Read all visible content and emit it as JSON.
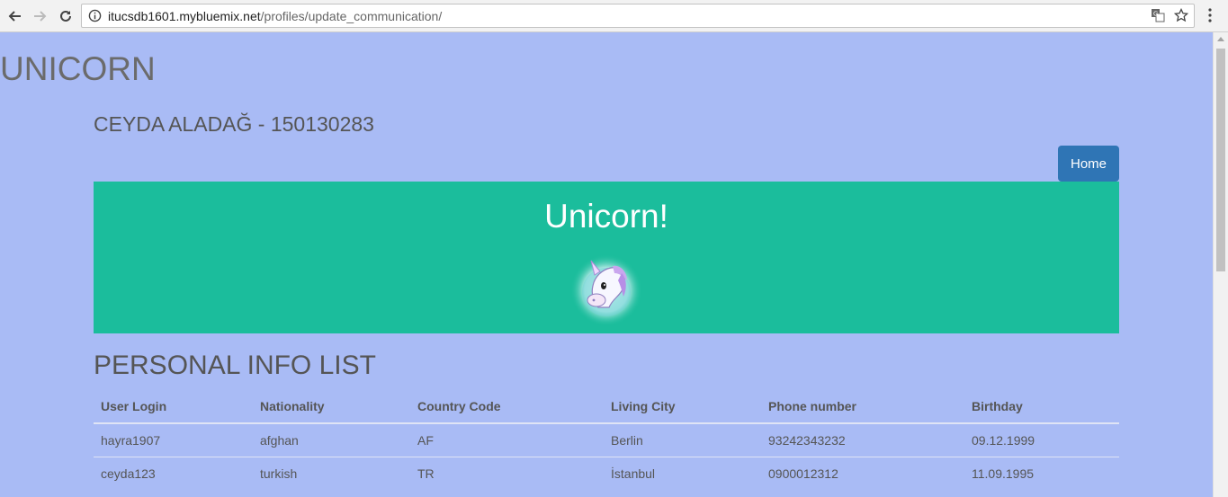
{
  "browser": {
    "url_host": "itucsdb1601.mybluemix.net",
    "url_path": "/profiles/update_communication/"
  },
  "site_title": "UNICORN",
  "person_heading": "CEYDA ALADAĞ - 150130283",
  "nav": {
    "home_label": "Home"
  },
  "hero": {
    "title": "Unicorn!",
    "image_icon": "unicorn-icon"
  },
  "section_title": "PERSONAL INFO LIST",
  "table": {
    "headers": [
      "User Login",
      "Nationality",
      "Country Code",
      "Living City",
      "Phone number",
      "Birthday"
    ],
    "rows": [
      [
        "hayra1907",
        "afghan",
        "AF",
        "Berlin",
        "93242343232",
        "09.12.1999"
      ],
      [
        "ceyda123",
        "turkish",
        "TR",
        "İstanbul",
        "0900012312",
        "11.09.1995"
      ]
    ]
  },
  "colors": {
    "page_bg": "#a9bbf5",
    "hero_bg": "#1bbd9c",
    "button_bg": "#2f75b5"
  }
}
